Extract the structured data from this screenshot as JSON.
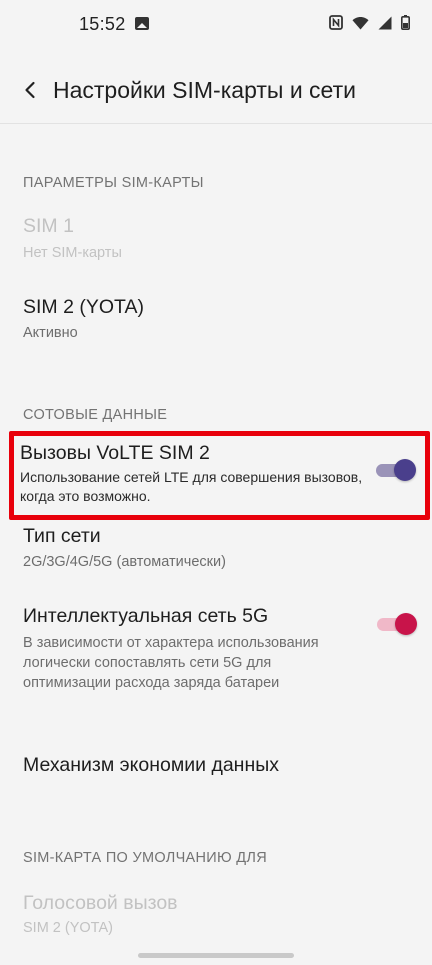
{
  "status_bar": {
    "time": "15:52",
    "icons": [
      "gallery-icon",
      "nfc-icon",
      "wifi-icon",
      "signal-icon",
      "battery-icon"
    ]
  },
  "header": {
    "title": "Настройки SIM-карты и сети",
    "back_icon": "chevron-left-icon"
  },
  "sections": {
    "sim_params": {
      "header": "ПАРАМЕТРЫ SIM-КАРТЫ",
      "sim1": {
        "title": "SIM 1",
        "subtitle": "Нет SIM-карты",
        "enabled": false
      },
      "sim2": {
        "title": "SIM 2  (YOTA)",
        "subtitle": "Активно"
      }
    },
    "cellular": {
      "header": "СОТОВЫЕ ДАННЫЕ",
      "volte": {
        "title": "Вызовы VoLTE SIM 2",
        "subtitle": "Использование сетей LTE для совершения вызовов, когда это возможно.",
        "toggle_on": true
      },
      "network_type": {
        "title": "Тип сети",
        "subtitle": "2G/3G/4G/5G (автоматически)"
      },
      "smart_5g": {
        "title": "Интеллектуальная сеть 5G",
        "subtitle": "В зависимости от характера использования логически сопоставлять сети 5G для оптимизации расхода заряда батареи",
        "toggle_on": true
      },
      "data_saver": {
        "title": "Механизм экономии данных"
      }
    },
    "default_sim": {
      "header": "SIM-КАРТА ПО УМОЛЧАНИЮ ДЛЯ",
      "voice_call": {
        "title": "Голосовой вызов",
        "subtitle": "SIM 2  (YOTA)",
        "enabled": false
      }
    }
  },
  "colors": {
    "highlight_border": "#e8000b",
    "volte_toggle_thumb": "#4a3f8c",
    "volte_toggle_track": "#9a93b8",
    "smart5g_toggle_thumb": "#c8144a",
    "smart5g_toggle_track": "#f0b8c8"
  }
}
